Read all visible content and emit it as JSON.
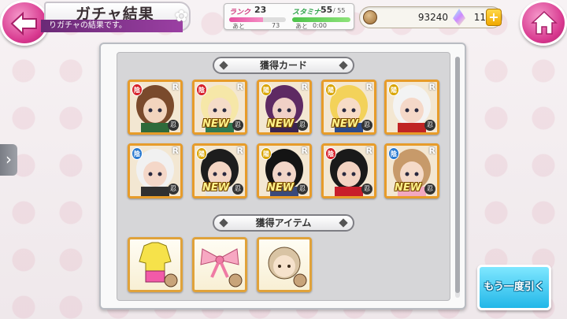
{
  "header": {
    "title": "ガチャ結果",
    "subtitle": "りガチャの結果です。"
  },
  "status": {
    "rank_label": "ランク",
    "rank_value": "23",
    "rank_next_label": "あと",
    "rank_next_value": "73",
    "stamina_label": "スタミナ",
    "stamina_value": "55",
    "stamina_max": "/ 55",
    "stamina_next_label": "あと",
    "stamina_time": "0:00"
  },
  "currency": {
    "coins": "93240",
    "gems": "11",
    "plus_label": "+"
  },
  "main": {
    "cards_header": "獲得カード",
    "items_header": "獲得アイテム",
    "cards": [
      {
        "attr": "陰",
        "attr_color": "#d6202a",
        "rarity": "R",
        "type": "忍",
        "new": "",
        "portrait": [
          "#7a4a2c",
          "#f2d4be",
          "#2f6a3a"
        ]
      },
      {
        "attr": "陰",
        "attr_color": "#d6202a",
        "rarity": "R",
        "type": "忍",
        "new": "NEW",
        "portrait": [
          "#f6e7a8",
          "#f5dcc8",
          "#2f7a52"
        ]
      },
      {
        "attr": "陽",
        "attr_color": "#d9a400",
        "rarity": "R",
        "type": "忍",
        "new": "NEW",
        "portrait": [
          "#5e2a63",
          "#f0d0c6",
          "#3b2450"
        ]
      },
      {
        "attr": "陽",
        "attr_color": "#d9a400",
        "rarity": "R",
        "type": "忍",
        "new": "NEW",
        "portrait": [
          "#f3d25a",
          "#f7dcc6",
          "#2c4a8a"
        ]
      },
      {
        "attr": "陽",
        "attr_color": "#d9a400",
        "rarity": "R",
        "type": "忍",
        "new": "",
        "portrait": [
          "#f3f3f3",
          "#f5d8c8",
          "#c02424"
        ]
      },
      {
        "attr": "陰",
        "attr_color": "#2a7ad0",
        "rarity": "R",
        "type": "忍",
        "new": "",
        "portrait": [
          "#f1f1f1",
          "#f4d7c8",
          "#303030"
        ]
      },
      {
        "attr": "陽",
        "attr_color": "#d9a400",
        "rarity": "R",
        "type": "忍",
        "new": "NEW",
        "portrait": [
          "#1d1d1d",
          "#f4d6c4",
          "#e4e4e4"
        ]
      },
      {
        "attr": "陽",
        "attr_color": "#d9a400",
        "rarity": "R",
        "type": "忍",
        "new": "NEW",
        "portrait": [
          "#141414",
          "#f2d6c8",
          "#3a4a7a"
        ]
      },
      {
        "attr": "陰",
        "attr_color": "#d6202a",
        "rarity": "R",
        "type": "忍",
        "new": "",
        "portrait": [
          "#1a1a1a",
          "#f3d3c2",
          "#c81e2a"
        ]
      },
      {
        "attr": "陰",
        "attr_color": "#2a7ad0",
        "rarity": "R",
        "type": "忍",
        "new": "NEW",
        "portrait": [
          "#c79a6a",
          "#f5dac8",
          "#f2a8c0"
        ]
      }
    ],
    "items": [
      {
        "name": "yellow-outfit-item"
      },
      {
        "name": "pink-ribbon-item"
      },
      {
        "name": "character-face-item"
      }
    ]
  },
  "again_button": "もう一度引く"
}
